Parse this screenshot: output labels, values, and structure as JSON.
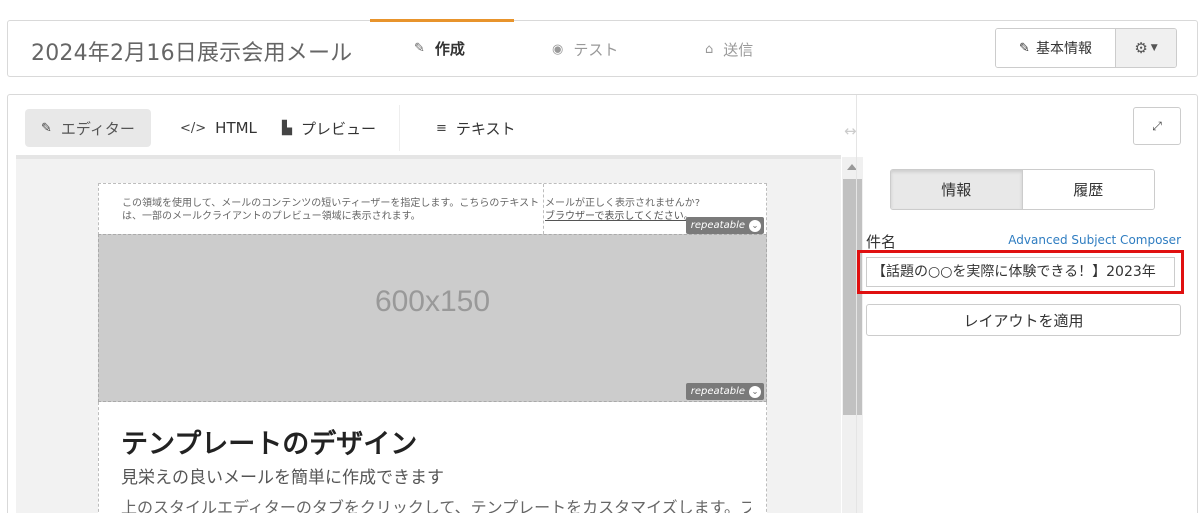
{
  "header": {
    "email_title": "2024年2月16日展示会用メール",
    "steps": [
      {
        "label": "作成",
        "icon": "edit-icon",
        "active": true
      },
      {
        "label": "テスト",
        "icon": "target-icon",
        "active": false
      },
      {
        "label": "送信",
        "icon": "inbox-icon",
        "active": false
      }
    ],
    "basic_info_label": "基本情報",
    "accent_color": "#e8942c"
  },
  "toolbar": {
    "editor_label": "エディター",
    "html_label": "HTML",
    "preview_label": "プレビュー",
    "text_label": "テキスト"
  },
  "email_preview": {
    "preheader_text": "この領域を使用して、メールのコンテンツの短いティーザーを指定します。こちらのテキストは、一部のメールクライアントのプレビュー領域に表示されます。",
    "view_online_prompt": "メールが正しく表示されませんか?",
    "view_in_browser_link": "ブラウザーで表示してください。",
    "repeatable_label": "repeatable",
    "placeholder_image_label": "600x150",
    "template_title": "テンプレートのデザイン",
    "template_subtitle": "見栄えの良いメールを簡単に作成できます",
    "template_body": "上のスタイルエディターのタブをクリックして、テンプレートをカスタマイズします。フ"
  },
  "sidebar": {
    "tabs": [
      {
        "label": "情報",
        "active": true
      },
      {
        "label": "履歴",
        "active": false
      }
    ],
    "subject_label": "件名",
    "advanced_subject_link": "Advanced Subject Composer",
    "subject_value": "【話題の○○を実際に体験できる！】2023年",
    "apply_layout_label": "レイアウトを適用",
    "highlight_color": "#e01010"
  }
}
